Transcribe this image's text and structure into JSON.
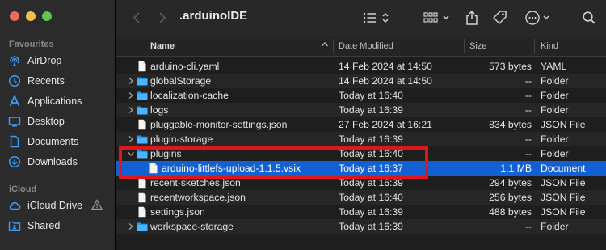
{
  "window": {
    "title": ".arduinoIDE"
  },
  "sidebar": {
    "favourites_label": "Favourites",
    "items": [
      {
        "label": "AirDrop",
        "icon": "airdrop-icon"
      },
      {
        "label": "Recents",
        "icon": "clock-icon"
      },
      {
        "label": "Applications",
        "icon": "applications-icon"
      },
      {
        "label": "Desktop",
        "icon": "desktop-icon"
      },
      {
        "label": "Documents",
        "icon": "document-icon"
      },
      {
        "label": "Downloads",
        "icon": "download-icon"
      }
    ],
    "icloud_label": "iCloud",
    "icloud_items": [
      {
        "label": "iCloud Drive",
        "icon": "cloud-icon"
      },
      {
        "label": "Shared",
        "icon": "shared-folder-icon"
      }
    ]
  },
  "columns": {
    "name": "Name",
    "date": "Date Modified",
    "size": "Size",
    "kind": "Kind"
  },
  "files": [
    {
      "name": "arduino-cli.yaml",
      "date": "14 Feb 2024 at 14:50",
      "size": "573 bytes",
      "kind": "YAML",
      "type": "file",
      "disclosure": ""
    },
    {
      "name": "globalStorage",
      "date": "14 Feb 2024 at 14:50",
      "size": "--",
      "kind": "Folder",
      "type": "folder",
      "disclosure": ">"
    },
    {
      "name": "localization-cache",
      "date": "Today at 16:40",
      "size": "--",
      "kind": "Folder",
      "type": "folder",
      "disclosure": ">"
    },
    {
      "name": "logs",
      "date": "Today at 16:39",
      "size": "--",
      "kind": "Folder",
      "type": "folder",
      "disclosure": ">"
    },
    {
      "name": "pluggable-monitor-settings.json",
      "date": "27 Feb 2024 at 16:21",
      "size": "834 bytes",
      "kind": "JSON File",
      "type": "file",
      "disclosure": ""
    },
    {
      "name": "plugin-storage",
      "date": "Today at 16:39",
      "size": "--",
      "kind": "Folder",
      "type": "folder",
      "disclosure": ">"
    },
    {
      "name": "plugins",
      "date": "Today at 16:40",
      "size": "--",
      "kind": "Folder",
      "type": "folder",
      "disclosure": "v"
    },
    {
      "name": "arduino-littlefs-upload-1.1.5.vsix",
      "date": "Today at 16:37",
      "size": "1,1 MB",
      "kind": "Document",
      "type": "file",
      "disclosure": "",
      "child": true,
      "selected": true
    },
    {
      "name": "recent-sketches.json",
      "date": "Today at 16:39",
      "size": "294 bytes",
      "kind": "JSON File",
      "type": "file",
      "disclosure": ""
    },
    {
      "name": "recentworkspace.json",
      "date": "Today at 16:40",
      "size": "256 bytes",
      "kind": "JSON File",
      "type": "file",
      "disclosure": ""
    },
    {
      "name": "settings.json",
      "date": "Today at 16:39",
      "size": "488 bytes",
      "kind": "JSON File",
      "type": "file",
      "disclosure": ""
    },
    {
      "name": "workspace-storage",
      "date": "Today at 16:39",
      "size": "--",
      "kind": "Folder",
      "type": "folder",
      "disclosure": ">"
    }
  ],
  "colors": {
    "accent": "#1260d1",
    "folder": "#1e9bf0",
    "highlight": "#e0161b",
    "sidebar_icon": "#3d9cf5"
  }
}
